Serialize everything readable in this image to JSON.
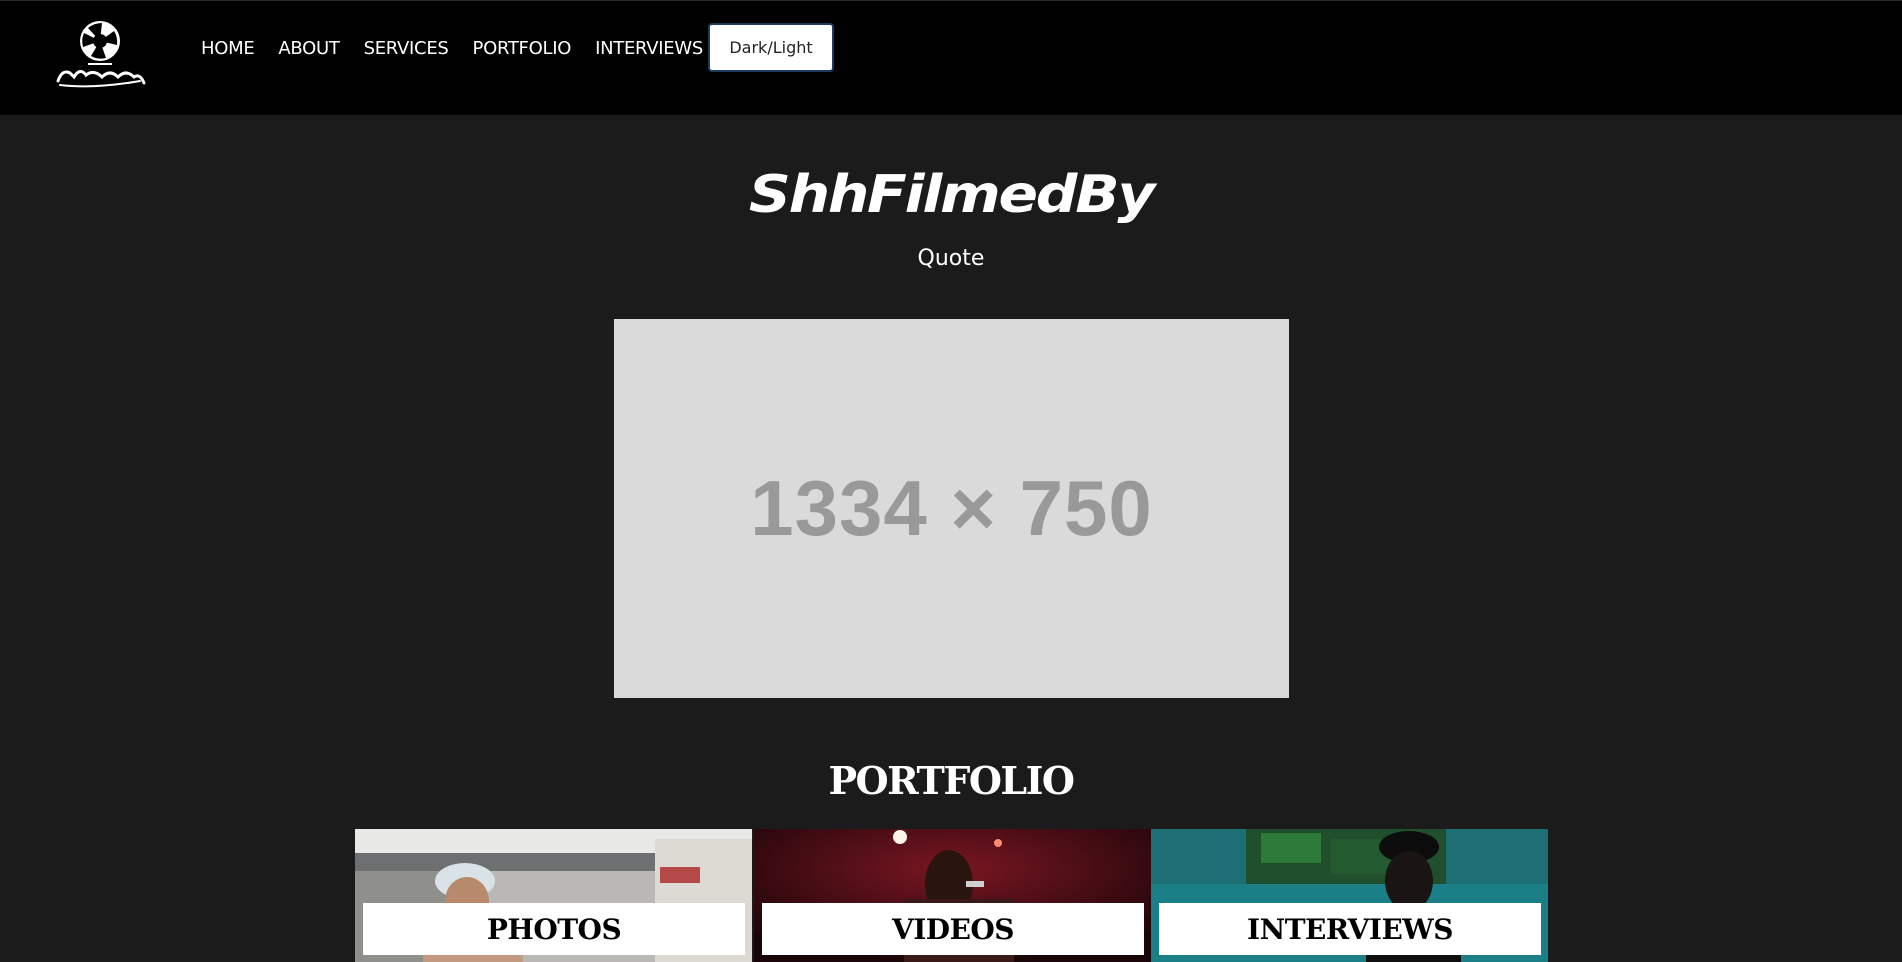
{
  "nav": {
    "links": [
      "HOME",
      "ABOUT",
      "SERVICES",
      "PORTFOLIO",
      "INTERVIEWS"
    ],
    "theme_toggle": "Dark/Light"
  },
  "hero": {
    "title": "ShhFilmedBy",
    "subtitle": "Quote",
    "placeholder_text": "1334 × 750"
  },
  "portfolio": {
    "heading": "PORTFOLIO",
    "cards": [
      "PHOTOS",
      "VIDEOS",
      "INTERVIEWS"
    ]
  },
  "colors": {
    "topbar_bg": "#000000",
    "page_bg": "#1b1b1b",
    "placeholder_bg": "#dadada",
    "placeholder_text": "#999999"
  },
  "icons": [
    "shutter-logo-icon"
  ]
}
